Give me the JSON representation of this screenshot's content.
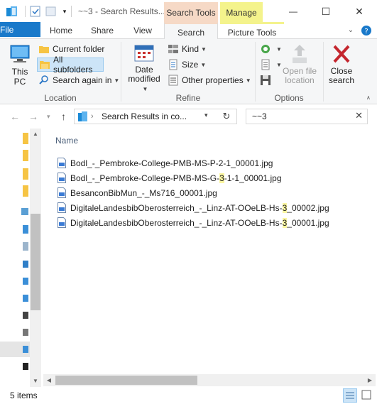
{
  "window": {
    "title": "~~3 - Search Results...",
    "minimize_glyph": "—",
    "maximize_glyph": "☐",
    "close_glyph": "✕"
  },
  "context_tabs": {
    "search_tools": "Search Tools",
    "manage": "Manage"
  },
  "ribbon_tabs": [
    "File",
    "Home",
    "Share",
    "View",
    "Search",
    "Picture Tools"
  ],
  "ribbon": {
    "location": {
      "this_pc": "This PC",
      "current_folder": "Current folder",
      "all_subfolders": "All subfolders",
      "search_again_in": "Search again in",
      "group_label": "Location"
    },
    "refine": {
      "date_modified": "Date modified",
      "kind": "Kind",
      "size": "Size",
      "other_properties": "Other properties",
      "group_label": "Refine"
    },
    "options": {
      "open_file_location": "Open file location",
      "group_label": "Options"
    },
    "close_search": "Close search"
  },
  "address": {
    "path": "Search Results in co...",
    "search_query": "~~3"
  },
  "content": {
    "column_name": "Name",
    "files": [
      {
        "before": "Bodl_-_Pembroke-College-PMB-MS-P-2-1_00001.jpg",
        "match": "",
        "after": ""
      },
      {
        "before": "Bodl_-_Pembroke-College-PMB-MS-G-",
        "match": "3",
        "after": "-1-1_00001.jpg"
      },
      {
        "before": "BesanconBibMun_-_Ms716_00001.jpg",
        "match": "",
        "after": ""
      },
      {
        "before": "DigitaleLandesbibOberosterreich_-_Linz-AT-OOeLB-Hs-",
        "match": "3",
        "after": "_00002.jpg"
      },
      {
        "before": "DigitaleLandesbibOberosterreich_-_Linz-AT-OOeLB-Hs-",
        "match": "3",
        "after": "_00001.jpg"
      }
    ]
  },
  "status": {
    "item_count": "5 items"
  },
  "colors": {
    "accent": "#1979ca",
    "search_tools_tab": "#f6d9c6",
    "manage_tab": "#f4f38c",
    "match_highlight": "#faf5a0",
    "close_search_x": "#c4262e"
  }
}
